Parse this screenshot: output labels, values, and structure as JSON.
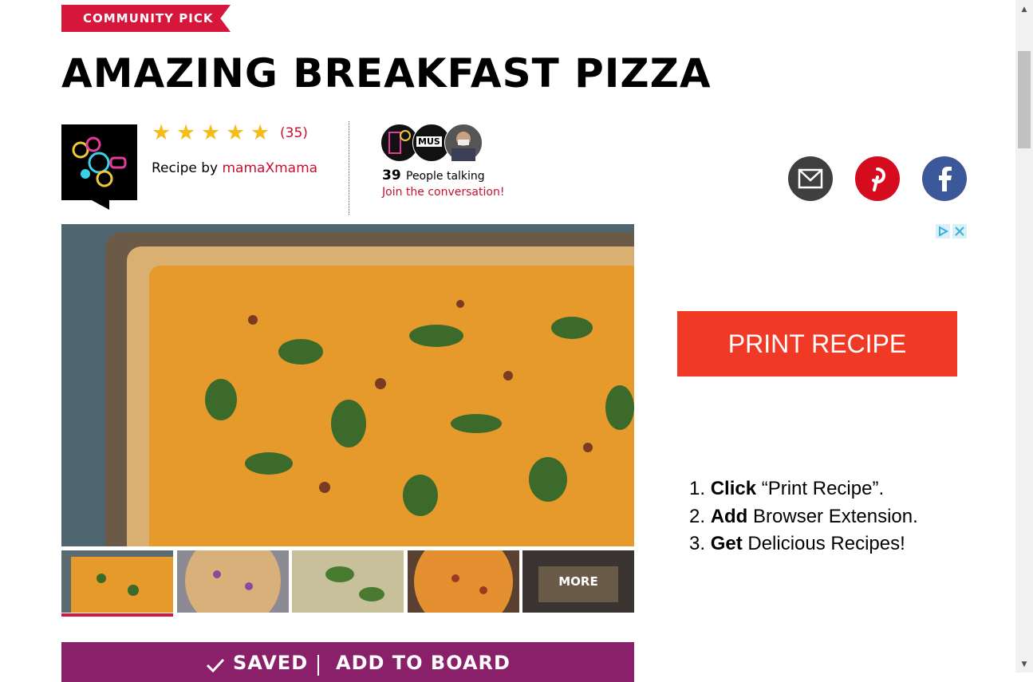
{
  "banner": {
    "label": "COMMUNITY PICK"
  },
  "title": "AMAZING BREAKFAST PIZZA",
  "rating": {
    "stars": 5,
    "count": "(35)"
  },
  "author": {
    "prefix": "Recipe by",
    "name": "mamaXmama"
  },
  "conversation": {
    "count": "39",
    "label": "People talking",
    "join": "Join the conversation!",
    "avatar_text": "MUS"
  },
  "share": {
    "email_icon": "envelope-icon",
    "pinterest_icon": "pinterest-icon",
    "facebook_icon": "facebook-icon"
  },
  "gallery": {
    "more_label": "MORE",
    "thumb_count": 5,
    "active_index": 0
  },
  "save_bar": {
    "saved_label": "SAVED",
    "add_label": "ADD TO BOARD"
  },
  "ad": {
    "print_label": "PRINT RECIPE",
    "steps": [
      {
        "num": "1.",
        "bold": "Click",
        "rest": " “Print Recipe”."
      },
      {
        "num": "2.",
        "bold": "Add",
        "rest": " Browser Extension."
      },
      {
        "num": "3.",
        "bold": "Get",
        "rest": " Delicious Recipes!"
      }
    ]
  },
  "colors": {
    "brand_red": "#d6163a",
    "save_purple": "#8a1f6a",
    "star": "#f5bd19",
    "ad_orange": "#f03a26"
  }
}
